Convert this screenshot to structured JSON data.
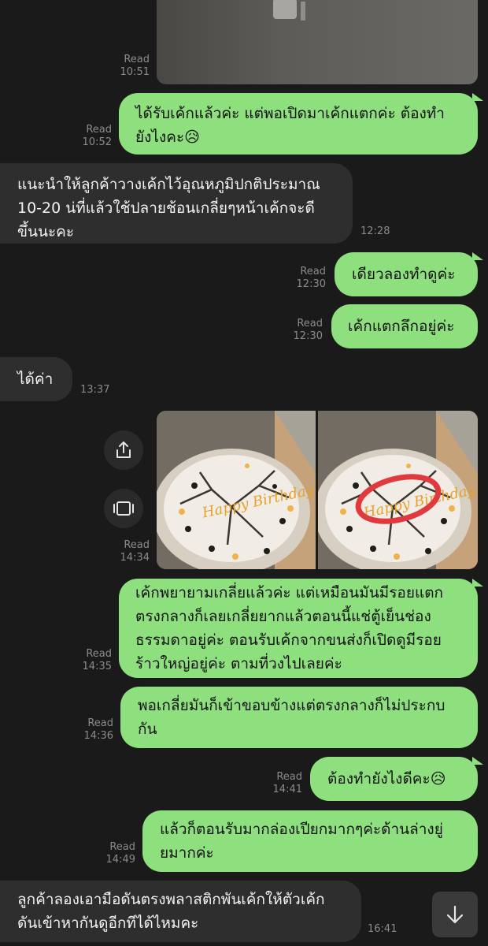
{
  "messages": [
    {
      "id": "m1",
      "direction": "out",
      "type": "image_top",
      "status": "Read",
      "time": "10:51"
    },
    {
      "id": "m2",
      "direction": "out",
      "text": "ได้รับเค้กแล้วค่ะ แต่พอเปิดมาเค้กแตกค่ะ ต้องทำ\nยังไงคะ😥",
      "status": "Read",
      "time": "10:52"
    },
    {
      "id": "m3",
      "direction": "in",
      "text": "แนะนำให้ลูกค้าวางเค้กไว้อุณหภูมิปกติประมาณ\n10-20 น่ที่แล้วใช้ปลายช้อนเกลี่ยๆหน้าเค้กจะดี\nขึ้นนะคะ",
      "time": "12:28"
    },
    {
      "id": "m4",
      "direction": "out",
      "text": "เดียวลองทำดูค่ะ",
      "status": "Read",
      "time": "12:30"
    },
    {
      "id": "m5",
      "direction": "out",
      "text": "เค้กแตกลึกอยู่ค่ะ",
      "status": "Read",
      "time": "12:30"
    },
    {
      "id": "m6",
      "direction": "in",
      "text": "ได้ค่า",
      "time": "13:37"
    },
    {
      "id": "m7",
      "direction": "out",
      "type": "images",
      "status": "Read",
      "time": "14:34",
      "cake_text": "Happy Birthday"
    },
    {
      "id": "m8",
      "direction": "out",
      "text": "เค้กพยายามเกลี่ยแล้วค่ะ แต่เหมือนมันมีรอยแตก\nตรงกลางก็เลยเกลี่ยยากแล้วตอนนี้แช่ตู้เย็นช่อง\nธรรมดาอยู่ค่ะ ตอนรับเค้กจากขนส่งก็เปิดดูมีรอย\nร้าวใหญ่อยู่ค่ะ ตามที่วงไปเลยค่ะ",
      "status": "Read",
      "time": "14:35"
    },
    {
      "id": "m9",
      "direction": "out",
      "text": "พอเกลี่ยมันก็เข้าขอบข้างแต่ตรงกลางก็ไม่ประกบ\nกัน",
      "status": "Read",
      "time": "14:36"
    },
    {
      "id": "m10",
      "direction": "out",
      "text": "ต้องทำยังไงดีคะ😥",
      "status": "Read",
      "time": "14:41"
    },
    {
      "id": "m11",
      "direction": "out",
      "text": "แล้วก็ตอนรับมากล่องเปียกมากๆค่ะด้านล่างยู่\nยมากค่ะ",
      "status": "Read",
      "time": "14:49"
    },
    {
      "id": "m12",
      "direction": "in",
      "text": "ลูกค้าลองเอามือดันตรงพลาสติกพันเค้กให้ตัวเค้ก\nดันเข้าหากันดูอีกทีได้ไหมคะ",
      "time": "16:41"
    }
  ],
  "icons": {
    "share": "share-icon",
    "gallery": "gallery-icon",
    "scroll_down": "arrow-down-icon"
  },
  "colors": {
    "background": "#1a1a1a",
    "outgoing_bubble": "#8de07d",
    "incoming_bubble": "#2e2e2e",
    "meta_text": "#8b8b8b",
    "annotation_circle": "#e0393e"
  }
}
